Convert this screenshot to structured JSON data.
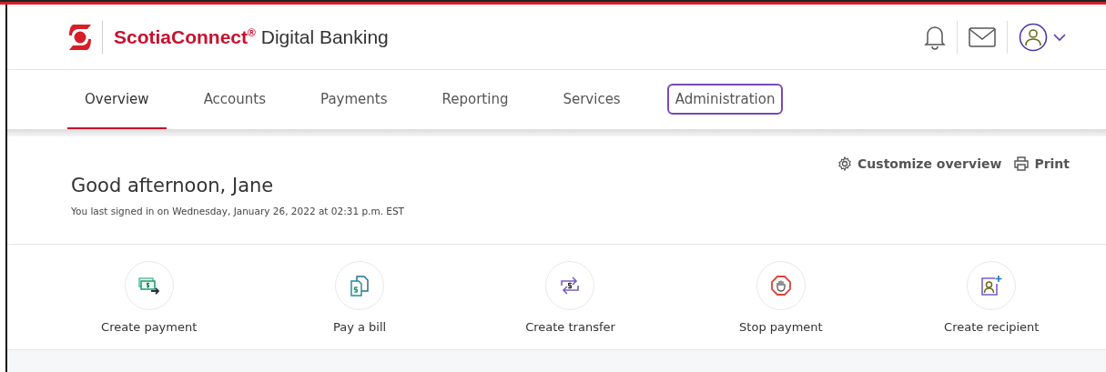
{
  "header": {
    "brand": "ScotiaConnect",
    "registered": "®",
    "product": "Digital Banking"
  },
  "tabs": [
    {
      "label": "Overview",
      "selected": true,
      "focused": false
    },
    {
      "label": "Accounts",
      "selected": false,
      "focused": false
    },
    {
      "label": "Payments",
      "selected": false,
      "focused": false
    },
    {
      "label": "Reporting",
      "selected": false,
      "focused": false
    },
    {
      "label": "Services",
      "selected": false,
      "focused": false
    },
    {
      "label": "Administration",
      "selected": false,
      "focused": true
    }
  ],
  "toolbar": [
    {
      "kind": "customize",
      "label": "Customize overview"
    },
    {
      "kind": "print",
      "label": "Print"
    }
  ],
  "greeting": {
    "title": "Good afternoon, Jane",
    "last_signin": "You last signed in on Wednesday, January 26, 2022 at 02:31 p.m. EST"
  },
  "quick_actions": [
    {
      "kind": "payment",
      "label": "Create payment"
    },
    {
      "kind": "bill",
      "label": "Pay a bill"
    },
    {
      "kind": "transfer",
      "label": "Create transfer"
    },
    {
      "kind": "stop",
      "label": "Stop payment"
    },
    {
      "kind": "recipient",
      "label": "Create recipient"
    }
  ]
}
